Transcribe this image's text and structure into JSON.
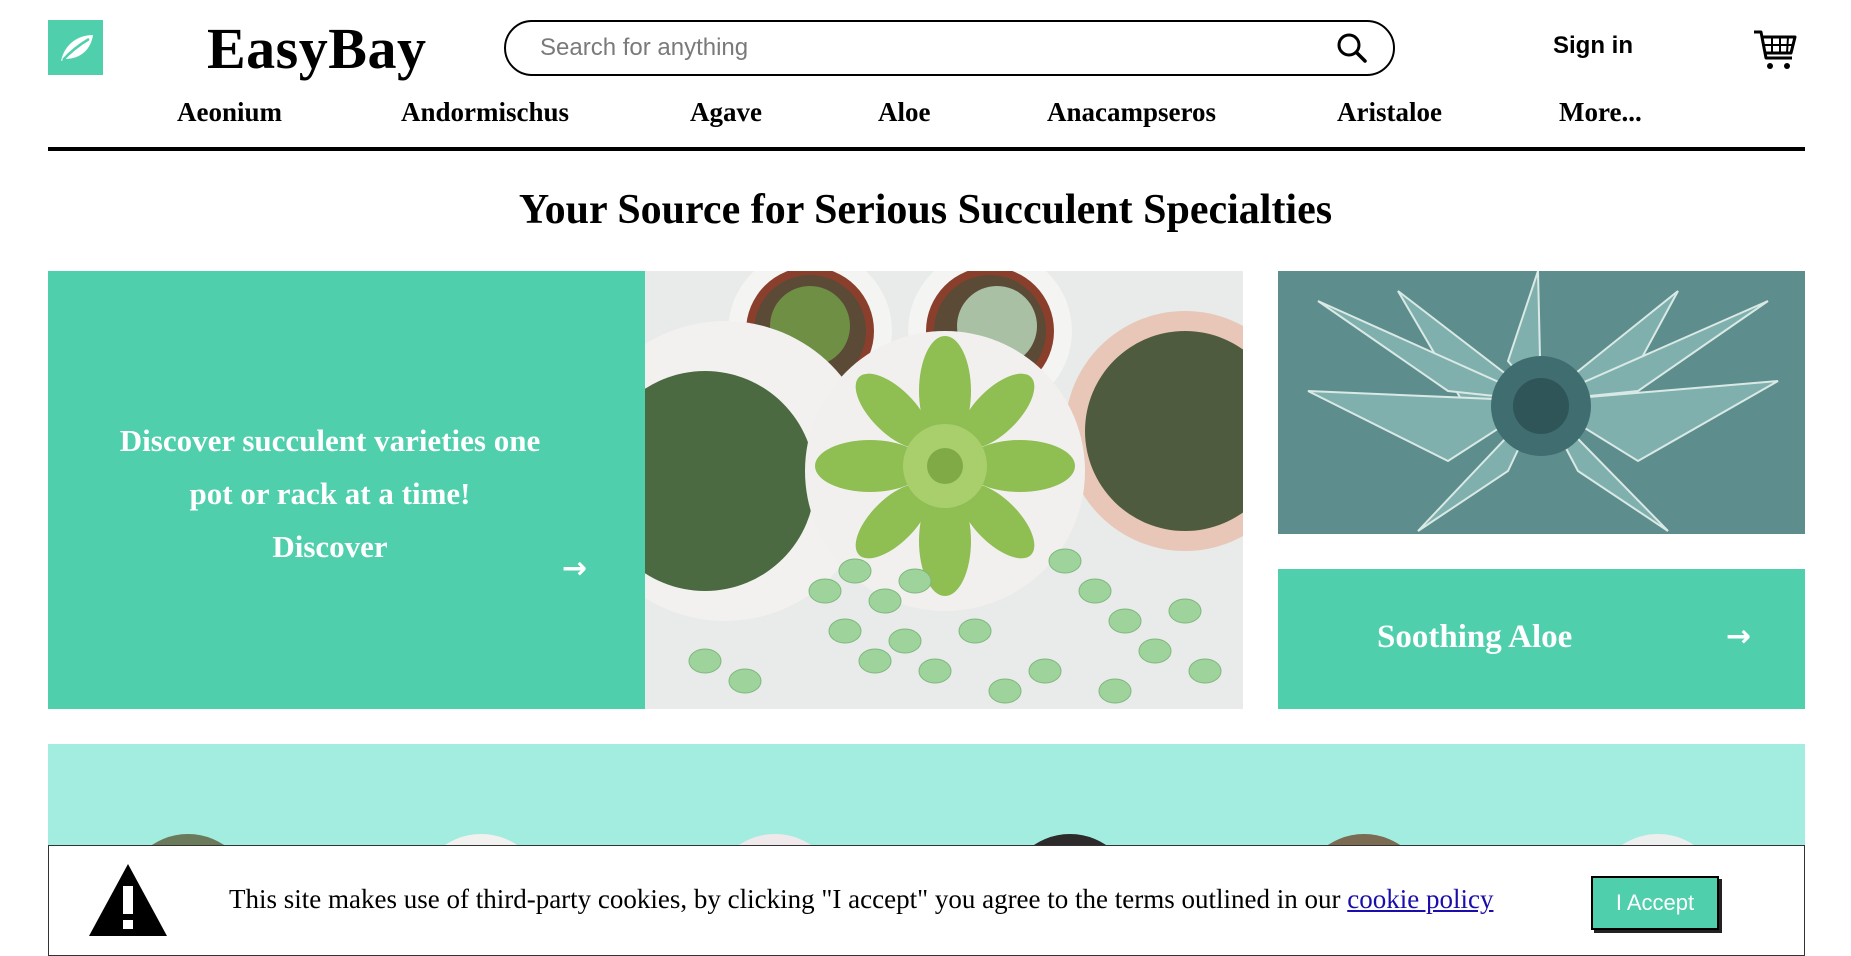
{
  "brand": {
    "name": "EasyBay",
    "logo_icon": "leaf-icon",
    "accent": "#4fcfac"
  },
  "search": {
    "placeholder": "Search for anything",
    "icon": "search-icon"
  },
  "header": {
    "sign_in": "Sign in",
    "cart_icon": "cart-icon"
  },
  "nav": {
    "items": [
      "Aeonium",
      "Andormischus",
      "Agave",
      "Aloe",
      "Anacampseros",
      "Aristaloe",
      "More..."
    ]
  },
  "hero": {
    "headline": "Your Source for Serious Succulent Specialties",
    "promo_line1": "Discover succulent varieties one",
    "promo_line2": "pot or rack at a time!",
    "promo_cta": "Discover",
    "arrow": "→",
    "aloe_label": "Soothing Aloe"
  },
  "category_strip": {
    "background": "#a3ede0"
  },
  "cookie": {
    "icon": "warning-icon",
    "text": "This site makes use of third-party cookies, by clicking \"I accept\" you agree to the terms outlined in our ",
    "link": "cookie policy",
    "accept": "I Accept"
  }
}
